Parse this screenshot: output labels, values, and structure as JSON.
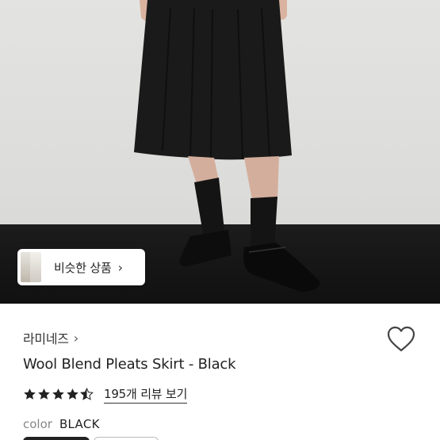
{
  "similar_button": {
    "label": "비슷한 상품",
    "arrow": "›"
  },
  "product": {
    "brand": "라미네즈",
    "brand_chevron": "›",
    "title": "Wool Blend Pleats Skirt - Black",
    "rating": 4.5,
    "review_link": "195개 리뷰 보기",
    "color_label": "color",
    "color_value": "BLACK"
  },
  "icons": {
    "similar_arrow": "chevron-right-icon",
    "brand": "chevron-right-icon",
    "wishlist": "heart-outline-icon",
    "rating": "star-icon"
  },
  "colors": {
    "star": "#222222",
    "heart_stroke": "#444444",
    "floor": "#151515",
    "wall": "#dededc"
  }
}
